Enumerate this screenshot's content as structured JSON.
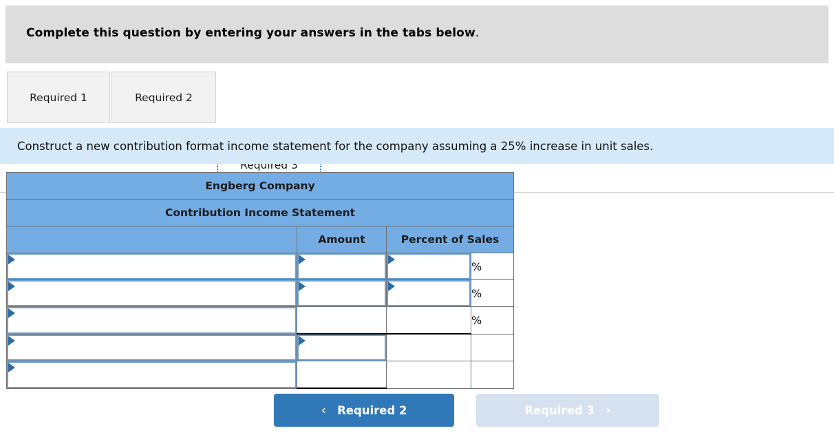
{
  "banner": {
    "text": "Complete this question by entering your answers in the tabs below",
    "period": "."
  },
  "tabs": [
    {
      "label": "Required 1",
      "active": false
    },
    {
      "label": "Required 2",
      "active": false
    },
    {
      "label": "Required 3",
      "active": true
    }
  ],
  "instruction": {
    "text": "Construct a new contribution format income statement for the company assuming a 25% increase in unit sales."
  },
  "table": {
    "title": "Engberg Company",
    "subtitle": "Contribution Income Statement",
    "columns": {
      "label": "",
      "amount": "Amount",
      "percent": "Percent of Sales",
      "symbol": ""
    },
    "rows": [
      {
        "label": "",
        "amount": "",
        "percent": "",
        "symbol": "%",
        "label_field": true,
        "amount_field": true,
        "percent_field": true
      },
      {
        "label": "",
        "amount": "",
        "percent": "",
        "symbol": "%",
        "label_field": true,
        "amount_field": true,
        "percent_field": true
      },
      {
        "label": "",
        "amount": "",
        "percent": "",
        "symbol": "%",
        "label_field": true,
        "amount_field": false,
        "percent_field": false
      },
      {
        "label": "",
        "amount": "",
        "percent": "",
        "symbol": "",
        "label_field": true,
        "amount_field": true,
        "percent_field": false
      },
      {
        "label": "",
        "amount": "",
        "percent": "",
        "symbol": "",
        "label_field": true,
        "amount_field": false,
        "percent_field": false
      }
    ]
  },
  "nav": {
    "prev_label": "Required 2",
    "prev_chevron": "‹",
    "next_label": "Required 3",
    "next_chevron": "›"
  },
  "colors": {
    "banner_bg": "#dddddd",
    "instruction_bg": "#d6e9f8",
    "table_header_bg": "#74ace4",
    "field_border": "#6b9fd0",
    "triangle": "#2e6ca8",
    "btn_active": "#3178b8",
    "btn_disabled": "#d6e1f0",
    "tab_focus": "#3a7ebf"
  }
}
